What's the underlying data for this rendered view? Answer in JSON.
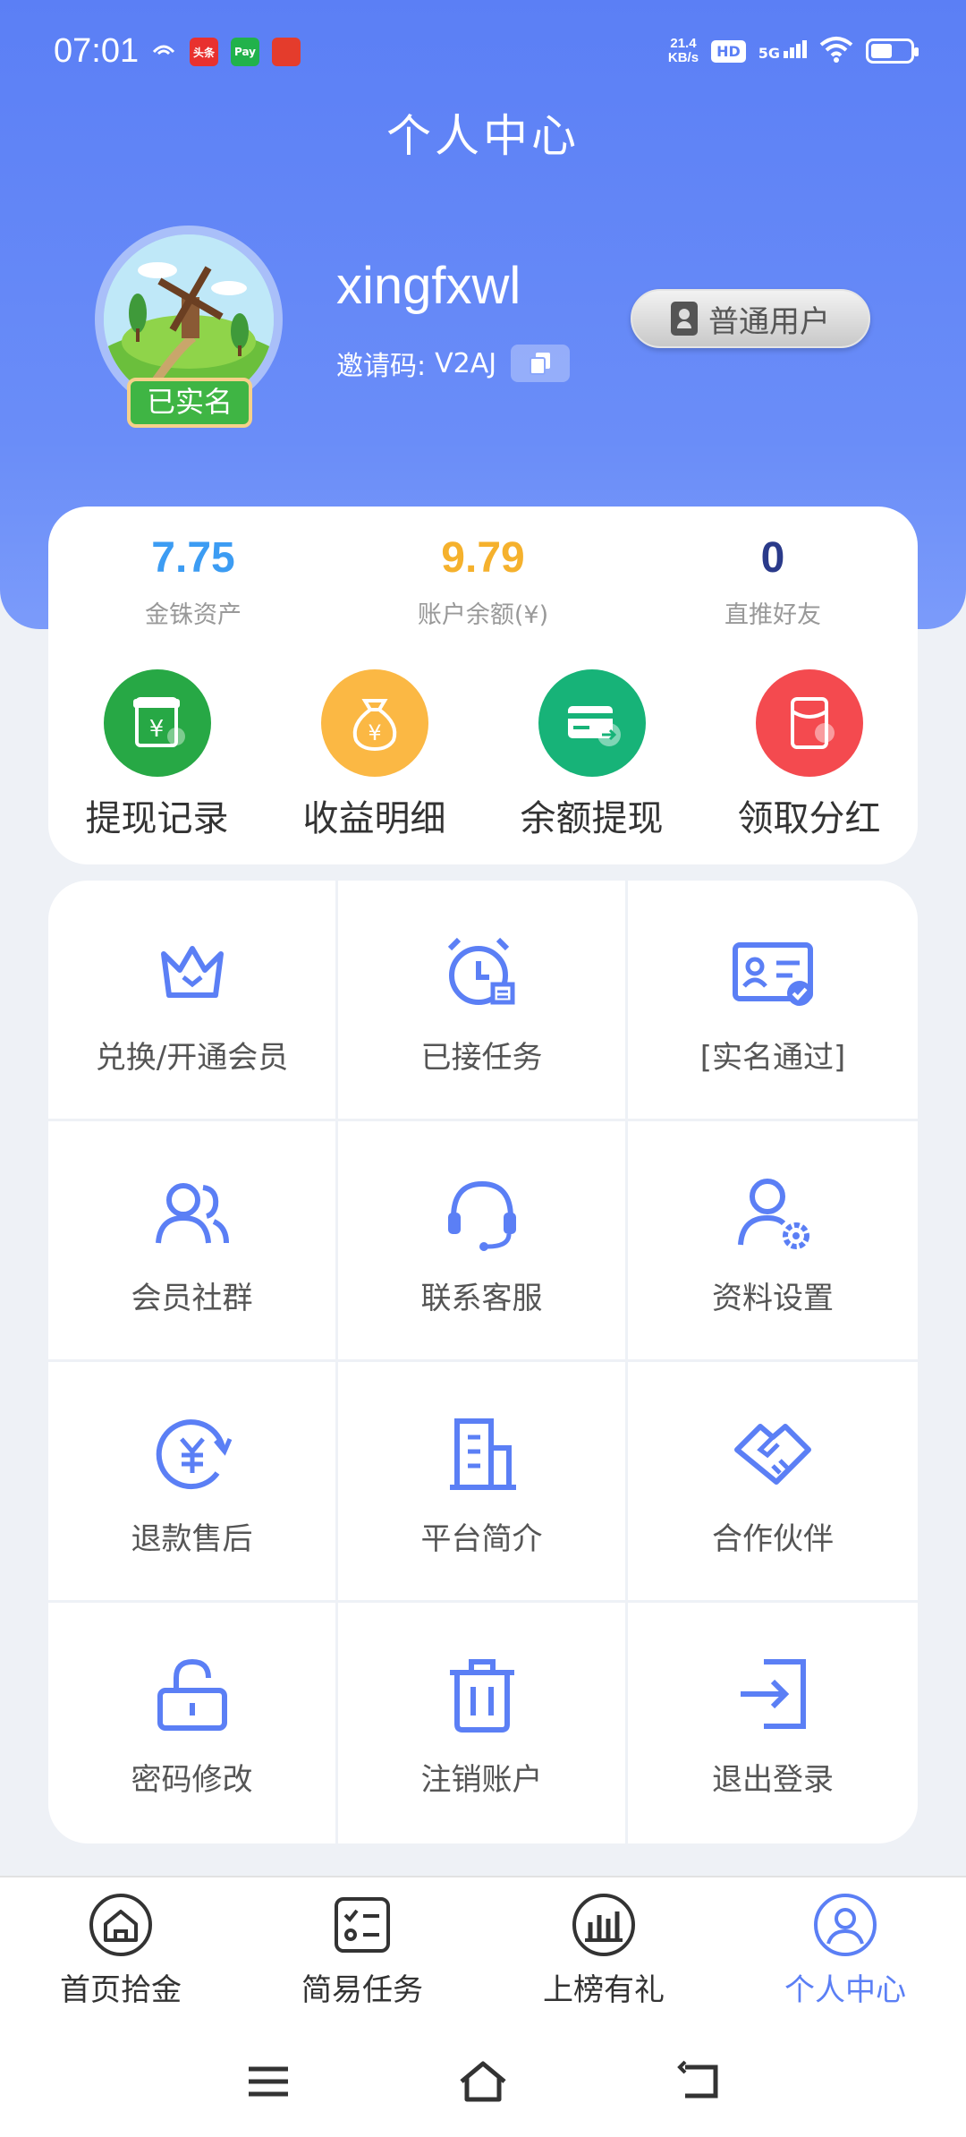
{
  "status_bar": {
    "time": "07:01",
    "net_speed_value": "21.4",
    "net_speed_unit": "KB/s",
    "hd": "HD",
    "network": "5G",
    "battery_level": 0.55,
    "apps": [
      {
        "name": "头条",
        "color": "#e8312f"
      },
      {
        "name": "Pay",
        "color": "#21b24b"
      },
      {
        "name": "",
        "color": "#e43c2c"
      }
    ]
  },
  "header": {
    "title": "个人中心"
  },
  "profile": {
    "verified_badge": "已实名",
    "username": "xingfxwl",
    "invite_label": "邀请码:",
    "invite_code": "V2AJ",
    "user_type": "普通用户"
  },
  "stats": [
    {
      "value": "7.75",
      "label": "金铢资产",
      "color": "#3c9cf3"
    },
    {
      "value": "9.79",
      "label": "账户余额(¥)",
      "color": "#f5b12d"
    },
    {
      "value": "0",
      "label": "直推好友",
      "color": "#2a3a8a"
    }
  ],
  "actions": [
    {
      "label": "提现记录",
      "color": "#27a845",
      "icon": "withdraw-record-icon"
    },
    {
      "label": "收益明细",
      "color": "#fbb844",
      "icon": "money-bag-icon"
    },
    {
      "label": "余额提现",
      "color": "#17b378",
      "icon": "card-transfer-icon"
    },
    {
      "label": "领取分红",
      "color": "#f44a4f",
      "icon": "red-envelope-icon"
    }
  ],
  "menu": [
    {
      "label": "兑换/开通会员",
      "icon": "crown-icon"
    },
    {
      "label": "已接任务",
      "icon": "alarm-clock-icon"
    },
    {
      "label": "[实名通过]",
      "icon": "id-card-check-icon"
    },
    {
      "label": "会员社群",
      "icon": "users-icon"
    },
    {
      "label": "联系客服",
      "icon": "headset-icon"
    },
    {
      "label": "资料设置",
      "icon": "user-settings-icon"
    },
    {
      "label": "退款售后",
      "icon": "yuan-refresh-icon"
    },
    {
      "label": "平台简介",
      "icon": "building-icon"
    },
    {
      "label": "合作伙伴",
      "icon": "handshake-icon"
    },
    {
      "label": "密码修改",
      "icon": "unlock-icon"
    },
    {
      "label": "注销账户",
      "icon": "trash-icon"
    },
    {
      "label": "退出登录",
      "icon": "logout-icon"
    }
  ],
  "tabs": [
    {
      "label": "首页拾金",
      "icon": "home-icon",
      "active": false
    },
    {
      "label": "简易任务",
      "icon": "checklist-icon",
      "active": false
    },
    {
      "label": "上榜有礼",
      "icon": "bar-chart-icon",
      "active": false
    },
    {
      "label": "个人中心",
      "icon": "user-circle-icon",
      "active": true
    }
  ],
  "colors": {
    "accent": "#5b7ff5",
    "icon_stroke": "#5b7ff5"
  }
}
